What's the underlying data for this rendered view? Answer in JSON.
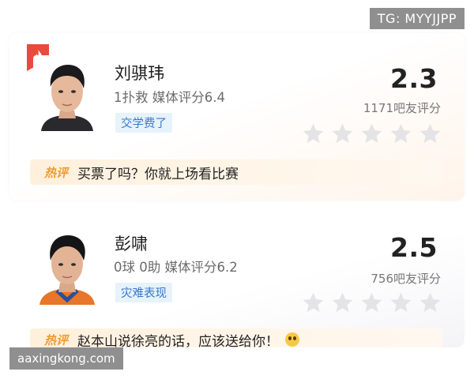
{
  "watermarks": {
    "top": "TG: MYYJJPP",
    "bottom": "aaxingkong.com"
  },
  "colors": {
    "tag_text": "#3a78c8",
    "tag_bg": "#e6f3fb",
    "hot_label": "#f29a2e",
    "star_empty": "#e4e4e6",
    "badge_red": "#e84a3c"
  },
  "players": [
    {
      "name": "刘骐玮",
      "stats": "1扑救  媒体评分6.4",
      "tag": "交学费了",
      "score": "2.3",
      "votes": "1171吧友评分",
      "stars_filled": 0,
      "stars_total": 5,
      "has_top_badge": true,
      "badge_icon": "flame-icon",
      "hot_comment": {
        "label": "热评",
        "text": "买票了吗？你就上场看比赛"
      }
    },
    {
      "name": "彭啸",
      "stats": "0球 0助  媒体评分6.2",
      "tag": "灾难表现",
      "score": "2.5",
      "votes": "756吧友评分",
      "stars_filled": 0,
      "stars_total": 5,
      "has_top_badge": false,
      "hot_comment": {
        "label": "热评",
        "text": "赵本山说徐亮的话，应该送给你！"
      }
    }
  ]
}
